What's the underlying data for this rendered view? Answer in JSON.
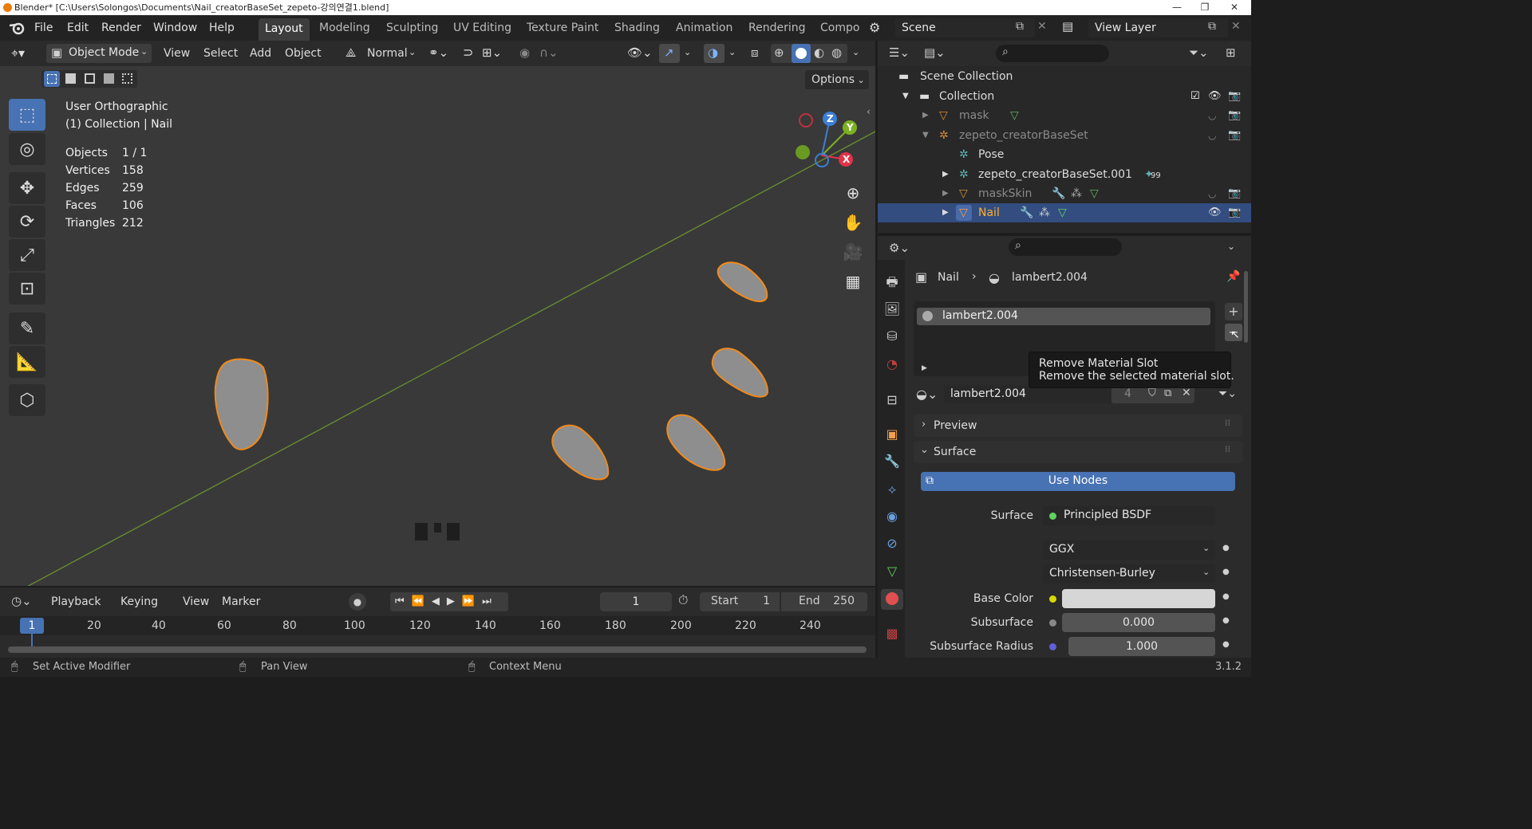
{
  "window": {
    "title": "Blender* [C:\\Users\\Solongos\\Documents\\Nail_creatorBaseSet_zepeto-강의연결1.blend]",
    "minimize": "—",
    "maximize": "❐",
    "close": "✕"
  },
  "menu": {
    "items": [
      "File",
      "Edit",
      "Render",
      "Window",
      "Help"
    ],
    "workspaces": [
      "Layout",
      "Modeling",
      "Sculpting",
      "UV Editing",
      "Texture Paint",
      "Shading",
      "Animation",
      "Rendering",
      "Compo"
    ],
    "active_workspace": "Layout",
    "scene": "Scene",
    "view_layer": "View Layer"
  },
  "viewport_header": {
    "mode": "Object Mode",
    "menus": [
      "View",
      "Select",
      "Add",
      "Object"
    ],
    "orientation": "Normal",
    "options": "Options"
  },
  "viewport_info": {
    "view_name": "User Orthographic",
    "collection_line": "(1) Collection | Nail",
    "stats": [
      {
        "label": "Objects",
        "value": "1 / 1"
      },
      {
        "label": "Vertices",
        "value": "158"
      },
      {
        "label": "Edges",
        "value": "259"
      },
      {
        "label": "Faces",
        "value": "106"
      },
      {
        "label": "Triangles",
        "value": "212"
      }
    ]
  },
  "gizmo": {
    "z": "Z",
    "y": "Y",
    "x": "X"
  },
  "timeline": {
    "menus": [
      "Playback",
      "Keying",
      "View",
      "Marker"
    ],
    "current_frame": "1",
    "start_label": "Start",
    "start_value": "1",
    "end_label": "End",
    "end_value": "250",
    "ruler": [
      "1",
      "20",
      "40",
      "60",
      "80",
      "100",
      "120",
      "140",
      "160",
      "180",
      "200",
      "220",
      "240"
    ]
  },
  "statusbar": {
    "left": "Set Active Modifier",
    "middle": "Pan View",
    "right": "Context Menu",
    "version": "3.1.2"
  },
  "outliner": {
    "scene_collection": "Scene Collection",
    "rows": [
      {
        "label": "Collection"
      },
      {
        "label": "mask"
      },
      {
        "label": "zepeto_creatorBaseSet"
      },
      {
        "label": "Pose"
      },
      {
        "label": "zepeto_creatorBaseSet.001",
        "badge": "99"
      },
      {
        "label": "maskSkin"
      },
      {
        "label": "Nail"
      }
    ]
  },
  "properties": {
    "breadcrumb_object": "Nail",
    "breadcrumb_material": "lambert2.004",
    "slot_name": "lambert2.004",
    "material_name": "lambert2.004",
    "user_count": "4",
    "tooltip_title": "Remove Material Slot",
    "tooltip_body": "Remove the selected material slot.",
    "preview_panel": "Preview",
    "surface_panel": "Surface",
    "use_nodes": "Use Nodes",
    "surface_label": "Surface",
    "surface_shader": "Principled BSDF",
    "distribution": "GGX",
    "subsurface_method": "Christensen-Burley",
    "base_color_label": "Base Color",
    "base_color": "#d6d6d6",
    "subsurface_label": "Subsurface",
    "subsurface_value": "0.000",
    "subsurface_radius_label": "Subsurface Radius",
    "subsurface_radius_value": "1.000"
  }
}
